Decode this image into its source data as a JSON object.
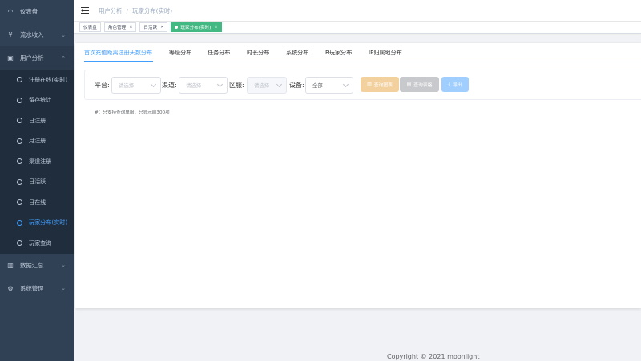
{
  "sidebar": {
    "items": [
      {
        "label": "仪表盘",
        "icon": "dashboard-icon",
        "glyph": "◠",
        "has_chevron": false
      },
      {
        "label": "流水收入",
        "icon": "yen-icon",
        "glyph": "¥",
        "has_chevron": true
      },
      {
        "label": "用户分析",
        "icon": "user-card-icon",
        "glyph": "▣",
        "has_chevron": true,
        "open": true
      }
    ],
    "sub_items": [
      {
        "label": "注册在线(实时)",
        "active": false
      },
      {
        "label": "留存统计",
        "active": false
      },
      {
        "label": "日注册",
        "active": false
      },
      {
        "label": "月注册",
        "active": false
      },
      {
        "label": "渠道注册",
        "active": false
      },
      {
        "label": "日活跃",
        "active": false
      },
      {
        "label": "日在线",
        "active": false
      },
      {
        "label": "玩家分布(实时)",
        "active": true
      },
      {
        "label": "玩家查询",
        "active": false
      }
    ],
    "bottom_items": [
      {
        "label": "数据汇总",
        "icon": "bar-chart-icon",
        "glyph": "▥",
        "has_chevron": true
      },
      {
        "label": "系统管理",
        "icon": "gear-icon",
        "glyph": "⚙",
        "has_chevron": true
      }
    ]
  },
  "breadcrumb": {
    "parent": "用户分析",
    "separator": "/",
    "current": "玩家分布(实时)"
  },
  "tags": [
    {
      "label": "仪表盘",
      "closable": false,
      "active": false
    },
    {
      "label": "角色管理",
      "closable": true,
      "active": false
    },
    {
      "label": "日活跃",
      "closable": true,
      "active": false
    },
    {
      "label": "玩家分布(实时)",
      "closable": true,
      "active": true
    }
  ],
  "tabs": [
    {
      "label": "首次充值距离注册天数分布",
      "active": true
    },
    {
      "label": "等级分布",
      "active": false
    },
    {
      "label": "任务分布",
      "active": false
    },
    {
      "label": "时长分布",
      "active": false
    },
    {
      "label": "系统分布",
      "active": false
    },
    {
      "label": "R玩家分布",
      "active": false
    },
    {
      "label": "IP归属地分布",
      "active": false
    }
  ],
  "filters": {
    "platform_label": "平台",
    "platform_placeholder": "请选择",
    "channel_label": "渠道",
    "channel_placeholder": "请选择",
    "server_label": "区服",
    "server_placeholder": "请选择",
    "device_label": "设备",
    "device_value": "全部"
  },
  "buttons": {
    "query_chart": "查询图表",
    "query_table": "查询表格",
    "export": "导出"
  },
  "note": "#：只支持查询单服，只显示前300项",
  "footer": "Copyright © 2021 moonlight",
  "colors": {
    "sidebar_bg": "#304156",
    "sidebar_text": "#bfcbd9",
    "active_blue": "#409eff",
    "tag_active_green": "#42b983"
  }
}
